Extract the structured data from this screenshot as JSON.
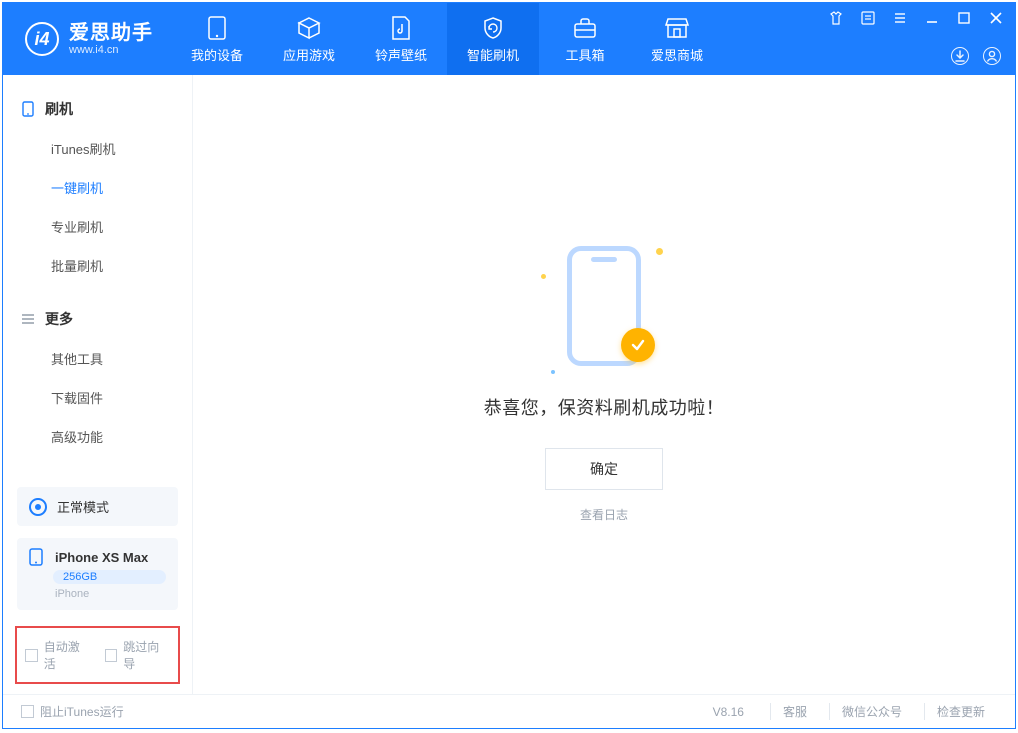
{
  "brand": {
    "title": "爱思助手",
    "subtitle": "www.i4.cn"
  },
  "nav": {
    "items": [
      {
        "label": "我的设备"
      },
      {
        "label": "应用游戏"
      },
      {
        "label": "铃声壁纸"
      },
      {
        "label": "智能刷机"
      },
      {
        "label": "工具箱"
      },
      {
        "label": "爱思商城"
      }
    ]
  },
  "sidebar": {
    "group_flash": {
      "title": "刷机",
      "items": [
        {
          "label": "iTunes刷机"
        },
        {
          "label": "一键刷机"
        },
        {
          "label": "专业刷机"
        },
        {
          "label": "批量刷机"
        }
      ]
    },
    "group_more": {
      "title": "更多",
      "items": [
        {
          "label": "其他工具"
        },
        {
          "label": "下载固件"
        },
        {
          "label": "高级功能"
        }
      ]
    },
    "mode": {
      "label": "正常模式"
    },
    "device": {
      "name": "iPhone XS Max",
      "capacity": "256GB",
      "model": "iPhone"
    },
    "options": {
      "auto_activate": "自动激活",
      "skip_guide": "跳过向导"
    }
  },
  "main": {
    "success_msg": "恭喜您，保资料刷机成功啦！",
    "ok_label": "确定",
    "view_log": "查看日志"
  },
  "statusbar": {
    "block_itunes": "阻止iTunes运行",
    "version": "V8.16",
    "links": [
      {
        "label": "客服"
      },
      {
        "label": "微信公众号"
      },
      {
        "label": "检查更新"
      }
    ]
  }
}
